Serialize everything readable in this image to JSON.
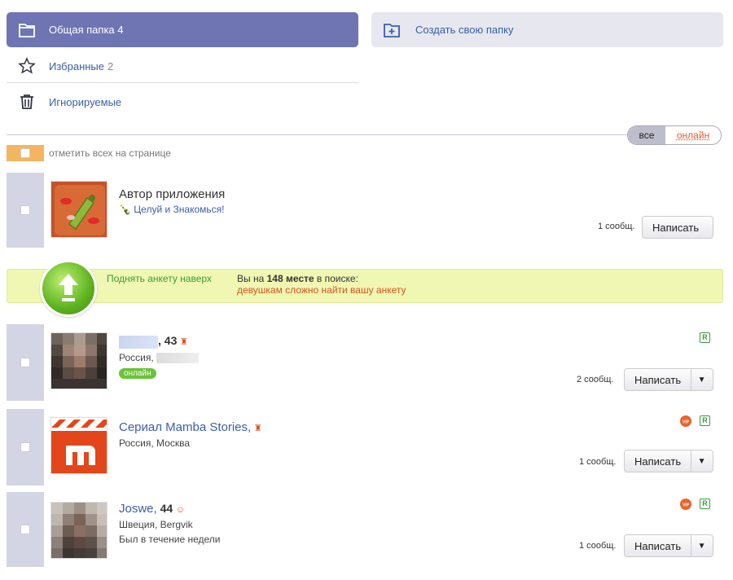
{
  "folders": {
    "active": {
      "label": "Общая папка 4"
    },
    "create": {
      "label": "Создать свою папку"
    },
    "favorites": {
      "label": "Избранные",
      "count": "2"
    },
    "ignored": {
      "label": "Игнорируемые"
    }
  },
  "filter": {
    "all": "все",
    "online": "онлайн"
  },
  "select_all": {
    "label": "отметить всех на странице"
  },
  "app_row": {
    "title": "Автор приложения",
    "link": "Целуй и Знакомься!",
    "msg_count": "1 сообщ.",
    "button": "Написать"
  },
  "promo": {
    "raise_label": "Поднять анкету наверх",
    "position_prefix": "Вы на ",
    "position_bold": "148 месте",
    "position_suffix": " в поиске:",
    "warning": "девушкам сложно найти вашу анкету"
  },
  "profiles": [
    {
      "name": "",
      "age": ", 43",
      "location": "Россия, ",
      "status": "онлайн",
      "msg_count": "2 сообщ.",
      "button": "Написать",
      "badge": "R"
    },
    {
      "name": "Сериал Mamba Stories,",
      "age": "",
      "location": "Россия, Москва",
      "msg_count": "1 сообщ.",
      "button": "Написать",
      "badge": "R",
      "vip": "VIP"
    },
    {
      "name": "Joswe,",
      "age": " 44",
      "location": "Швеция, Bergvik",
      "last_seen": "Был в течение недели",
      "msg_count": "1 сообщ.",
      "button": "Написать",
      "badge": "R",
      "vip": "VIP"
    }
  ],
  "colors": {
    "accent": "#6f75b3",
    "link": "#3a5fa6",
    "online_green": "#6cc23a",
    "warning": "#d9531e",
    "promo_bg": "#eff7b2"
  }
}
